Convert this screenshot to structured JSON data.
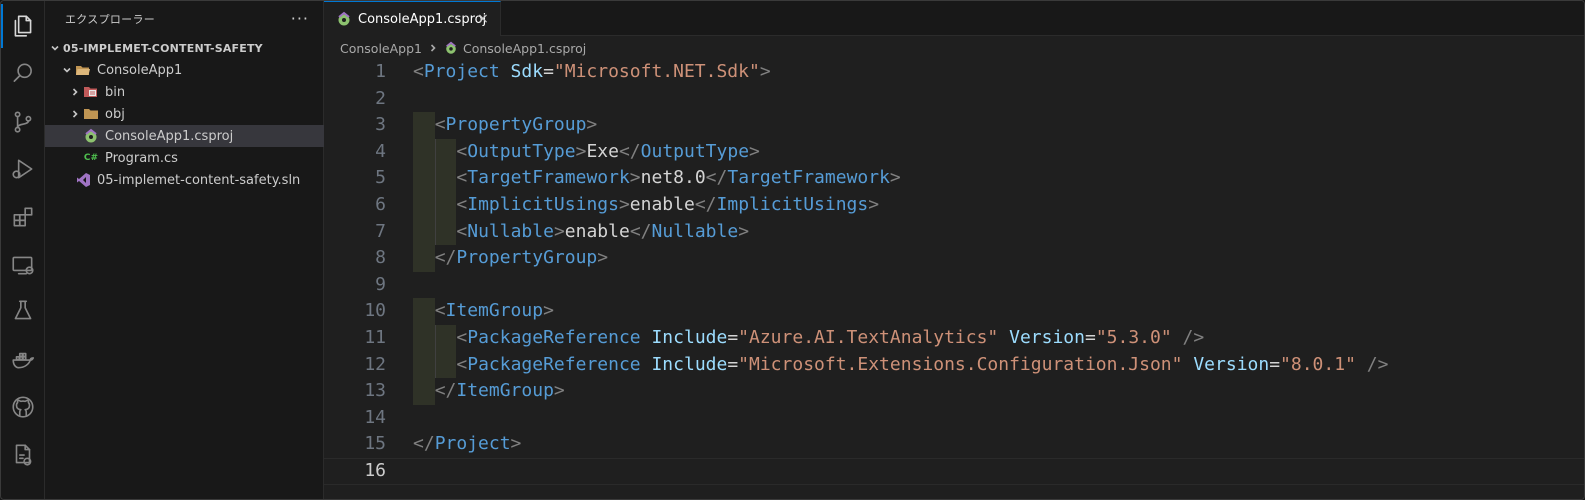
{
  "activity_bar": {
    "items": [
      {
        "name": "explorer-icon",
        "active": true
      },
      {
        "name": "search-icon",
        "active": false
      },
      {
        "name": "source-control-icon",
        "active": false
      },
      {
        "name": "run-debug-icon",
        "active": false
      },
      {
        "name": "extensions-icon",
        "active": false
      },
      {
        "name": "remote-explorer-icon",
        "active": false
      },
      {
        "name": "testing-icon",
        "active": false
      },
      {
        "name": "docker-icon",
        "active": false
      },
      {
        "name": "github-icon",
        "active": false
      },
      {
        "name": "solution-explorer-icon",
        "active": false
      }
    ]
  },
  "sidebar": {
    "title": "エクスプローラー",
    "more": "···",
    "tree": [
      {
        "label": "05-IMPLEMET-CONTENT-SAFETY",
        "level": 0,
        "chevron": "down",
        "icon": "",
        "root": true
      },
      {
        "label": "ConsoleApp1",
        "level": 1,
        "chevron": "down",
        "icon": "folder-open-icon"
      },
      {
        "label": "bin",
        "level": 2,
        "chevron": "right",
        "icon": "bin-folder-icon"
      },
      {
        "label": "obj",
        "level": 2,
        "chevron": "right",
        "icon": "folder-icon"
      },
      {
        "label": "ConsoleApp1.csproj",
        "level": 2,
        "chevron": "",
        "icon": "csproj-icon",
        "selected": true
      },
      {
        "label": "Program.cs",
        "level": 2,
        "chevron": "",
        "icon": "csharp-icon",
        "glyph": "C#"
      },
      {
        "label": "05-implemet-content-safety.sln",
        "level": 1,
        "chevron": "",
        "icon": "visual-studio-icon"
      }
    ]
  },
  "tab": {
    "label": "ConsoleApp1.csproj",
    "close": "×"
  },
  "breadcrumb": {
    "folder": "ConsoleApp1",
    "file": "ConsoleApp1.csproj"
  },
  "editor": {
    "current_line": 16,
    "lines": [
      {
        "n": "1",
        "indent": 0,
        "tokens": [
          [
            "t-br",
            "<"
          ],
          [
            "t-tag",
            "Project"
          ],
          [
            "t-txt",
            " "
          ],
          [
            "t-attr",
            "Sdk"
          ],
          [
            "t-txt",
            "="
          ],
          [
            "t-str",
            "\"Microsoft.NET.Sdk\""
          ],
          [
            "t-br",
            ">"
          ]
        ]
      },
      {
        "n": "2",
        "indent": 0,
        "tokens": []
      },
      {
        "n": "3",
        "indent": 1,
        "tokens": [
          [
            "t-br",
            "<"
          ],
          [
            "t-tag",
            "PropertyGroup"
          ],
          [
            "t-br",
            ">"
          ]
        ]
      },
      {
        "n": "4",
        "indent": 2,
        "tokens": [
          [
            "t-br",
            "<"
          ],
          [
            "t-tag",
            "OutputType"
          ],
          [
            "t-br",
            ">"
          ],
          [
            "t-txt",
            "Exe"
          ],
          [
            "t-br",
            "</"
          ],
          [
            "t-tag",
            "OutputType"
          ],
          [
            "t-br",
            ">"
          ]
        ]
      },
      {
        "n": "5",
        "indent": 2,
        "tokens": [
          [
            "t-br",
            "<"
          ],
          [
            "t-tag",
            "TargetFramework"
          ],
          [
            "t-br",
            ">"
          ],
          [
            "t-txt",
            "net8.0"
          ],
          [
            "t-br",
            "</"
          ],
          [
            "t-tag",
            "TargetFramework"
          ],
          [
            "t-br",
            ">"
          ]
        ]
      },
      {
        "n": "6",
        "indent": 2,
        "tokens": [
          [
            "t-br",
            "<"
          ],
          [
            "t-tag",
            "ImplicitUsings"
          ],
          [
            "t-br",
            ">"
          ],
          [
            "t-txt",
            "enable"
          ],
          [
            "t-br",
            "</"
          ],
          [
            "t-tag",
            "ImplicitUsings"
          ],
          [
            "t-br",
            ">"
          ]
        ]
      },
      {
        "n": "7",
        "indent": 2,
        "tokens": [
          [
            "t-br",
            "<"
          ],
          [
            "t-tag",
            "Nullable"
          ],
          [
            "t-br",
            ">"
          ],
          [
            "t-txt",
            "enable"
          ],
          [
            "t-br",
            "</"
          ],
          [
            "t-tag",
            "Nullable"
          ],
          [
            "t-br",
            ">"
          ]
        ]
      },
      {
        "n": "8",
        "indent": 1,
        "tokens": [
          [
            "t-br",
            "</"
          ],
          [
            "t-tag",
            "PropertyGroup"
          ],
          [
            "t-br",
            ">"
          ]
        ]
      },
      {
        "n": "9",
        "indent": 0,
        "tokens": []
      },
      {
        "n": "10",
        "indent": 1,
        "tokens": [
          [
            "t-br",
            "<"
          ],
          [
            "t-tag",
            "ItemGroup"
          ],
          [
            "t-br",
            ">"
          ]
        ]
      },
      {
        "n": "11",
        "indent": 2,
        "tokens": [
          [
            "t-br",
            "<"
          ],
          [
            "t-tag",
            "PackageReference"
          ],
          [
            "t-txt",
            " "
          ],
          [
            "t-attr",
            "Include"
          ],
          [
            "t-txt",
            "="
          ],
          [
            "t-str",
            "\"Azure.AI.TextAnalytics\""
          ],
          [
            "t-txt",
            " "
          ],
          [
            "t-attr",
            "Version"
          ],
          [
            "t-txt",
            "="
          ],
          [
            "t-str",
            "\"5.3.0\""
          ],
          [
            "t-txt",
            " "
          ],
          [
            "t-br",
            "/>"
          ]
        ]
      },
      {
        "n": "12",
        "indent": 2,
        "tokens": [
          [
            "t-br",
            "<"
          ],
          [
            "t-tag",
            "PackageReference"
          ],
          [
            "t-txt",
            " "
          ],
          [
            "t-attr",
            "Include"
          ],
          [
            "t-txt",
            "="
          ],
          [
            "t-str",
            "\"Microsoft.Extensions.Configuration.Json\""
          ],
          [
            "t-txt",
            " "
          ],
          [
            "t-attr",
            "Version"
          ],
          [
            "t-txt",
            "="
          ],
          [
            "t-str",
            "\"8.0.1\""
          ],
          [
            "t-txt",
            " "
          ],
          [
            "t-br",
            "/>"
          ]
        ]
      },
      {
        "n": "13",
        "indent": 1,
        "tokens": [
          [
            "t-br",
            "</"
          ],
          [
            "t-tag",
            "ItemGroup"
          ],
          [
            "t-br",
            ">"
          ]
        ]
      },
      {
        "n": "14",
        "indent": 0,
        "tokens": []
      },
      {
        "n": "15",
        "indent": 0,
        "tokens": [
          [
            "t-br",
            "</"
          ],
          [
            "t-tag",
            "Project"
          ],
          [
            "t-br",
            ">"
          ]
        ]
      },
      {
        "n": "16",
        "indent": 0,
        "tokens": []
      }
    ]
  },
  "colors": {
    "accent": "#0078d4",
    "tag": "#569cd6",
    "attr": "#9cdcfe",
    "string": "#ce9178"
  }
}
